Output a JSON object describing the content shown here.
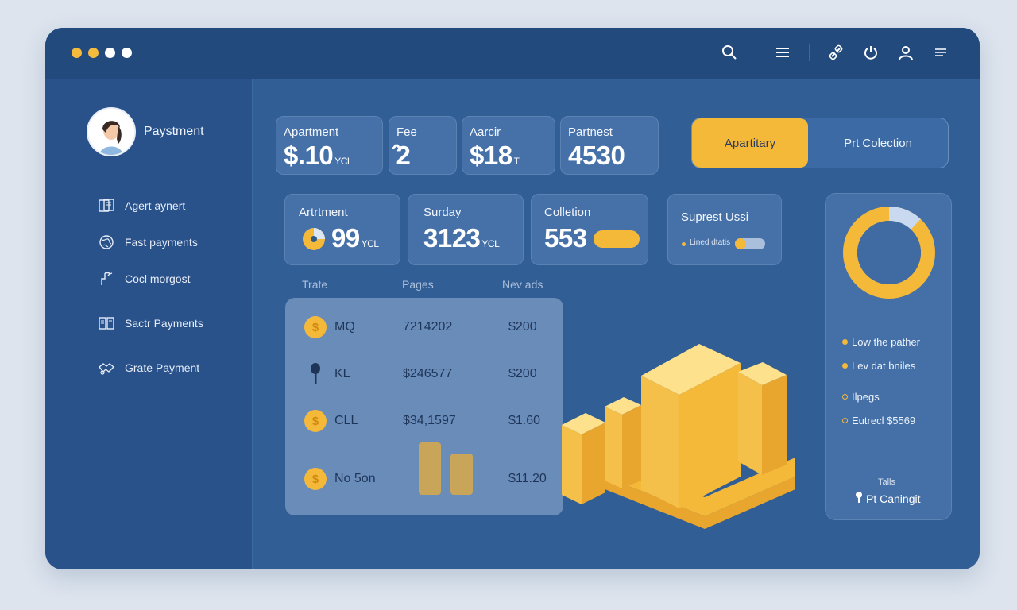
{
  "window": {
    "dots": [
      "#f5bb3d",
      "#f5bb3d",
      "#ffffff",
      "#ffffff"
    ],
    "toolbar_icons": [
      "search-icon",
      "menu-icon",
      "link-icon",
      "power-icon",
      "user-icon",
      "list-icon"
    ]
  },
  "sidebar": {
    "profile_name": "Paystment",
    "items": [
      {
        "label": "Agert aynert",
        "icon": "document-icon"
      },
      {
        "label": "Fast payments",
        "icon": "globe-icon"
      },
      {
        "label": "Cocl morgost",
        "icon": "wrench-icon"
      },
      {
        "label": "Sactr Payments",
        "icon": "book-icon"
      },
      {
        "label": "Grate Payment",
        "icon": "handshake-icon"
      }
    ]
  },
  "stats_top": [
    {
      "label": "Apartment",
      "value": "$.10",
      "unit": "YCL"
    },
    {
      "label": "Fee",
      "value": "̂2",
      "unit": ""
    },
    {
      "label": "Aarcir",
      "value": "$18",
      "unit": "T"
    },
    {
      "label": "Partnest",
      "value": "4530",
      "unit": ""
    }
  ],
  "segment": {
    "active": "Apartitary",
    "other": "Prt Colection"
  },
  "stats_mid": [
    {
      "label": "Artrtment",
      "value": "99",
      "unit": "YCL"
    },
    {
      "label": "Surday",
      "value": "3123",
      "unit": "YCL"
    },
    {
      "label": "Colletion",
      "value": "553",
      "unit": ""
    }
  ],
  "suprest": {
    "title": "Suprest Ussi",
    "legend": "Lined dtatis"
  },
  "table": {
    "headers": [
      "Trate",
      "Pages",
      "Nev ads"
    ],
    "rows": [
      {
        "icon": "dollar-coin-icon",
        "name": "MQ",
        "number": "7214202",
        "amount": "$200"
      },
      {
        "icon": "pin-icon",
        "name": "KL",
        "number": "$246577",
        "amount": "$200"
      },
      {
        "icon": "dollar-coin-icon",
        "name": "CLL",
        "number": "$34,1597",
        "amount": "$1.60"
      },
      {
        "icon": "dollar-coin-icon",
        "name": "No 5on",
        "number": "",
        "amount": "$11.20"
      }
    ]
  },
  "donut": {
    "highlight_fraction": 0.12,
    "ring_color": "#f5b93a",
    "highlight_color": "#c9d9ef"
  },
  "right_legend": [
    "Low the pather",
    "Lev dat bniles",
    "Ilpegs",
    "Eutrecl $5569"
  ],
  "footer": {
    "label": "Talls",
    "button": "Pt Caningit"
  },
  "colors": {
    "accent": "#f5b93a",
    "panel": "#315e95",
    "sidebar": "#29518a"
  }
}
